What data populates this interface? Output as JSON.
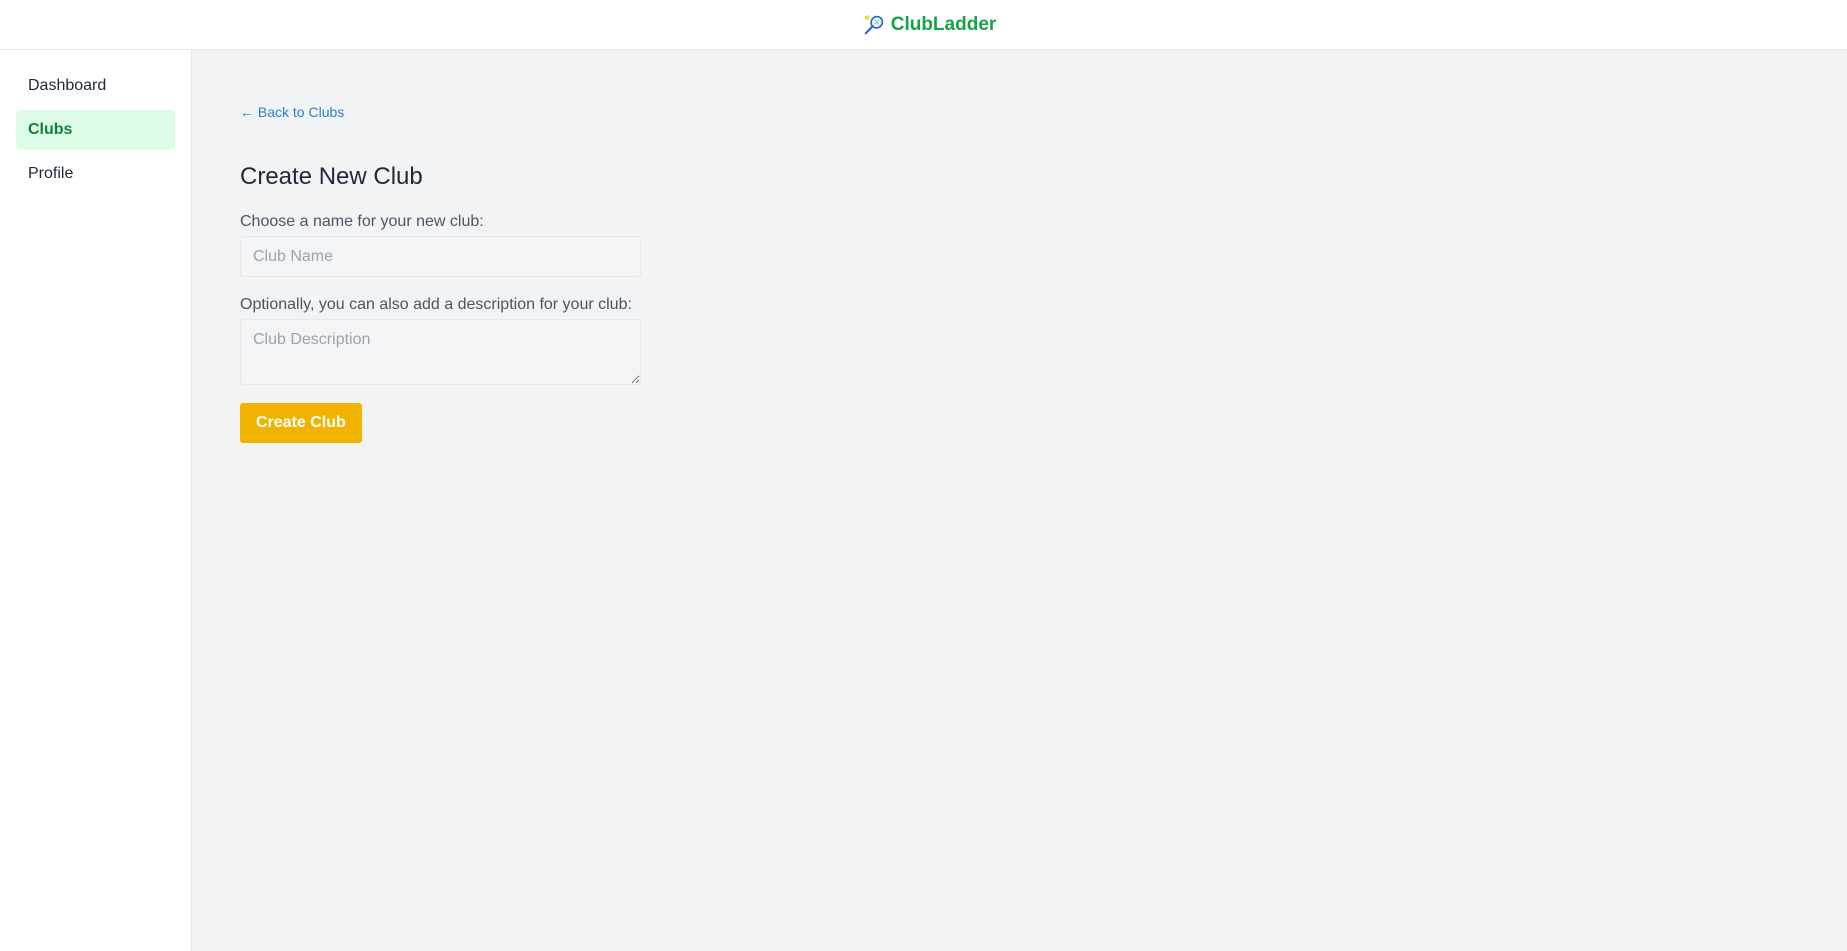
{
  "header": {
    "brand_icon": "tennis-racket-icon",
    "brand_name": "ClubLadder"
  },
  "sidebar": {
    "items": [
      {
        "label": "Dashboard",
        "active": false
      },
      {
        "label": "Clubs",
        "active": true
      },
      {
        "label": "Profile",
        "active": false
      }
    ]
  },
  "main": {
    "back_link": "← Back to Clubs",
    "title": "Create New Club",
    "name_label": "Choose a name for your new club:",
    "name_value": "",
    "name_placeholder": "Club Name",
    "description_label": "Optionally, you can also add a description for your club:",
    "description_value": "",
    "description_placeholder": "Club Description",
    "submit_label": "Create Club"
  },
  "colors": {
    "brand": "#16a34a",
    "active_nav_bg": "#dcfce7",
    "link": "#2e7dd1",
    "submit": "#f2b300"
  }
}
